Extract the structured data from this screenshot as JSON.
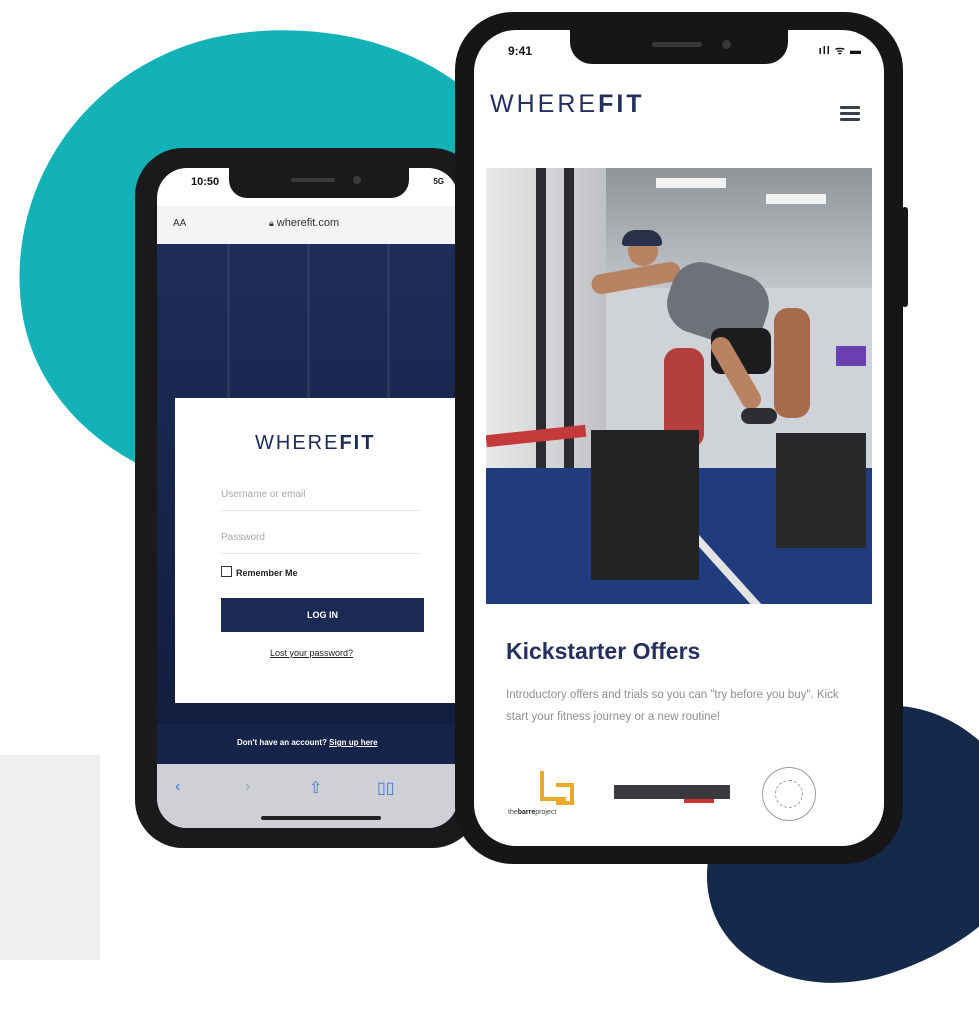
{
  "colors": {
    "teal_blob": "#13b2b7",
    "navy_blob": "#15294a",
    "brand_navy": "#1b2955",
    "body_text": "#8e8e94",
    "accent_gold": "#e8a92d"
  },
  "back_phone": {
    "status_time": "10:50",
    "status_right": "5G",
    "browser": {
      "text_size_label": "AA",
      "url": "wherefit.com",
      "lock_icon": "lock-icon"
    },
    "login": {
      "logo_light": "WHERE",
      "logo_bold": "FIT",
      "username_placeholder": "Username or email",
      "password_placeholder": "Password",
      "remember_label": "Remember Me",
      "login_button": "LOG IN",
      "lost_password": "Lost your password?",
      "no_account_text": "Don't have an account?",
      "sign_up_link": "Sign up here"
    },
    "toolbar_icons": [
      "back-icon",
      "forward-icon",
      "share-icon",
      "bookmarks-icon"
    ]
  },
  "front_phone": {
    "status_time": "9:41",
    "status_right": "ıll ᯤ ▬",
    "header": {
      "logo_light": "WHERE",
      "logo_bold": "FIT",
      "menu_icon": "hamburger-icon"
    },
    "section": {
      "title": "Kickstarter Offers",
      "description": "Introductory offers and trials so you can \"try before you buy\". Kick start your fitness journey or a new routine!"
    },
    "partners": {
      "barre_prefix": "the",
      "barre_bold": "barre",
      "barre_suffix": "project"
    }
  }
}
